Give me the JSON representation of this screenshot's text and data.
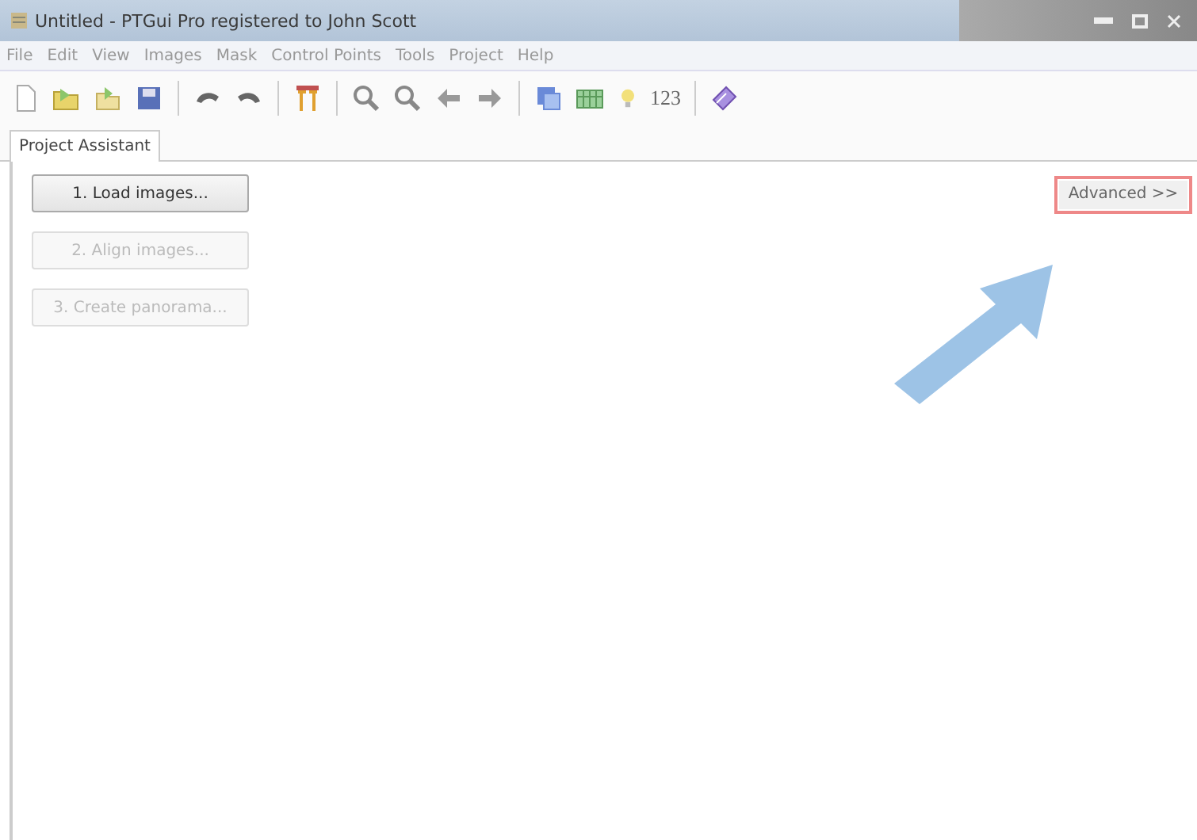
{
  "window": {
    "title": "Untitled - PTGui Pro registered to John Scott"
  },
  "menu": [
    "File",
    "Edit",
    "View",
    "Images",
    "Mask",
    "Control Points",
    "Tools",
    "Project",
    "Help"
  ],
  "toolbar": {
    "numbers_button": "123"
  },
  "tabs": [
    {
      "label": "Project Assistant",
      "selected": true
    }
  ],
  "steps": [
    {
      "label": "1. Load images...",
      "disabled": false
    },
    {
      "label": "2. Align images...",
      "disabled": true
    },
    {
      "label": "3. Create panorama...",
      "disabled": true
    }
  ],
  "advanced_button": {
    "label": "Advanced >>",
    "highlighted": true
  }
}
